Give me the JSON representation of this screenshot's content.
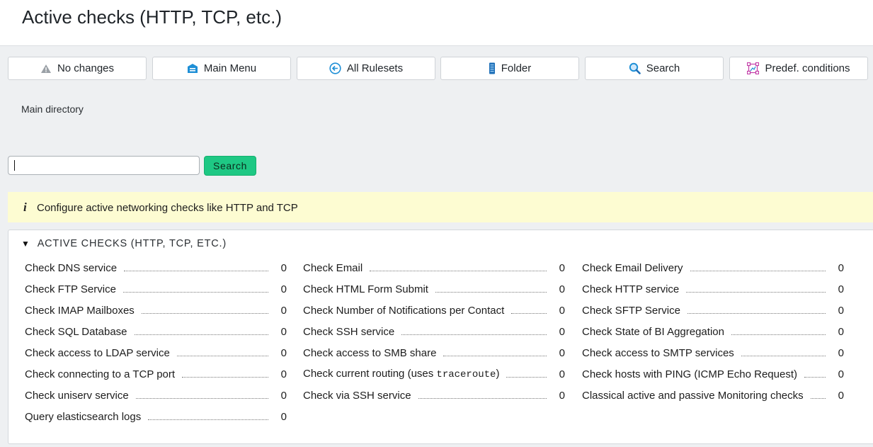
{
  "page": {
    "title": "Active checks (HTTP, TCP, etc.)"
  },
  "toolbar": {
    "buttons": [
      {
        "label": "No changes",
        "icon": "warning-icon"
      },
      {
        "label": "Main Menu",
        "icon": "main-menu-icon"
      },
      {
        "label": "All Rulesets",
        "icon": "back-arrow-icon"
      },
      {
        "label": "Folder",
        "icon": "folder-icon"
      },
      {
        "label": "Search",
        "icon": "search-icon"
      },
      {
        "label": "Predef. conditions",
        "icon": "predefined-conditions-icon"
      }
    ]
  },
  "breadcrumb": "Main directory",
  "search": {
    "value": "",
    "button_label": "Search"
  },
  "info": {
    "icon": "info-icon",
    "message": "Configure active networking checks like HTTP and TCP"
  },
  "section": {
    "title": "ACTIVE CHECKS (HTTP, TCP, ETC.)",
    "rulesets": [
      {
        "label": "Check DNS service",
        "count": "0"
      },
      {
        "label": "Check Email",
        "count": "0"
      },
      {
        "label": "Check Email Delivery",
        "count": "0"
      },
      {
        "label": "Check FTP Service",
        "count": "0"
      },
      {
        "label": "Check HTML Form Submit",
        "count": "0"
      },
      {
        "label": "Check HTTP service",
        "count": "0"
      },
      {
        "label": "Check IMAP Mailboxes",
        "count": "0"
      },
      {
        "label": "Check Number of Notifications per Contact",
        "count": "0"
      },
      {
        "label": "Check SFTP Service",
        "count": "0"
      },
      {
        "label": "Check SQL Database",
        "count": "0"
      },
      {
        "label": "Check SSH service",
        "count": "0"
      },
      {
        "label": "Check State of BI Aggregation",
        "count": "0"
      },
      {
        "label": "Check access to LDAP service",
        "count": "0"
      },
      {
        "label": "Check access to SMB share",
        "count": "0"
      },
      {
        "label": "Check access to SMTP services",
        "count": "0"
      },
      {
        "label": "Check connecting to a TCP port",
        "count": "0"
      },
      {
        "label_prefix": "Check current routing (uses ",
        "label_code": "traceroute",
        "label_suffix": ")",
        "count": "0"
      },
      {
        "label": "Check hosts with PING (ICMP Echo Request)",
        "count": "0"
      },
      {
        "label": "Check uniserv service",
        "count": "0"
      },
      {
        "label": "Check via SSH service",
        "count": "0"
      },
      {
        "label": "Classical active and passive Monitoring checks",
        "count": "0"
      },
      {
        "label": "Query elasticsearch logs",
        "count": "0"
      }
    ]
  }
}
